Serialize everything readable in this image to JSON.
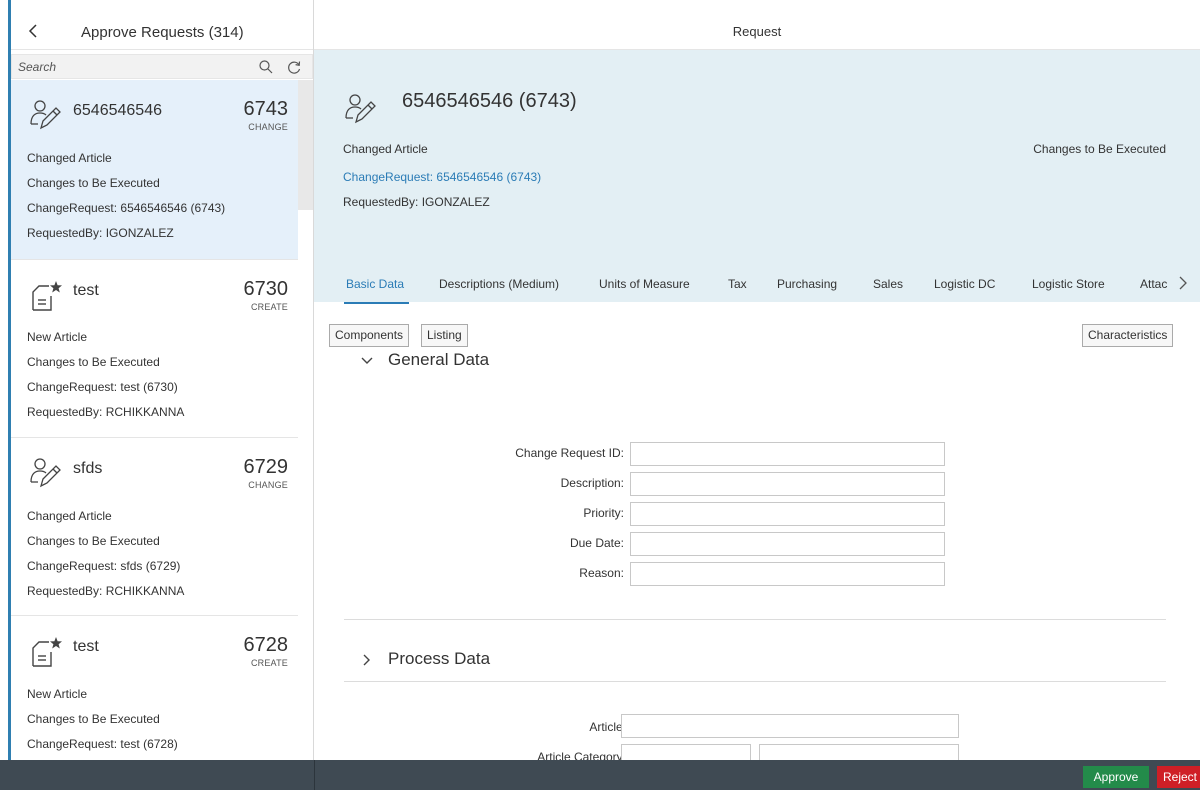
{
  "master": {
    "title": "Approve Requests (314)",
    "search_placeholder": "Search",
    "items": [
      {
        "title": "6546546546",
        "number": "6743",
        "unit": "CHANGE",
        "icon": "user-edit-icon",
        "attrs": [
          "Changed Article",
          "Changes to Be Executed",
          "ChangeRequest: 6546546546 (6743)",
          "RequestedBy: IGONZALEZ"
        ]
      },
      {
        "title": "test",
        "number": "6730",
        "unit": "CREATE",
        "icon": "document-favorite-icon",
        "attrs": [
          "New Article",
          "Changes to Be Executed",
          "ChangeRequest: test (6730)",
          "RequestedBy: RCHIKKANNA"
        ]
      },
      {
        "title": "sfds",
        "number": "6729",
        "unit": "CHANGE",
        "icon": "user-edit-icon",
        "attrs": [
          "Changed Article",
          "Changes to Be Executed",
          "ChangeRequest: sfds (6729)",
          "RequestedBy: RCHIKKANNA"
        ]
      },
      {
        "title": "test",
        "number": "6728",
        "unit": "CREATE",
        "icon": "document-favorite-icon",
        "attrs": [
          "New Article",
          "Changes to Be Executed",
          "ChangeRequest: test (6728)"
        ]
      }
    ]
  },
  "detail": {
    "title": "Request",
    "header": {
      "title": "6546546546 (6743)",
      "icon": "user-edit-icon",
      "type": "Changed Article",
      "link": "ChangeRequest: 6546546546 (6743)",
      "requested_by": "RequestedBy: IGONZALEZ",
      "status": "Changes to Be Executed"
    },
    "tabs": [
      "Basic Data",
      "Descriptions (Medium)",
      "Units of Measure",
      "Tax",
      "Purchasing",
      "Sales",
      "Logistic DC",
      "Logistic Store",
      "Attac"
    ],
    "buttons": {
      "components": "Components",
      "listing": "Listing",
      "characteristics": "Characteristics"
    },
    "general_data": {
      "title": "General Data",
      "fields": [
        "Change Request ID:",
        "Description:",
        "Priority:",
        "Due Date:",
        "Reason:"
      ]
    },
    "process_data": {
      "title": "Process Data",
      "fields": [
        "Article:",
        "Article Category:"
      ]
    }
  },
  "footer": {
    "approve": "Approve",
    "reject": "Reject"
  },
  "colors": {
    "accent": "#2b7cb6",
    "header_bg": "#e3eff4",
    "selected_bg": "#e5f0fa",
    "footer_bg": "#3f4a53",
    "approve": "#238b4a",
    "reject": "#cf1f26"
  }
}
